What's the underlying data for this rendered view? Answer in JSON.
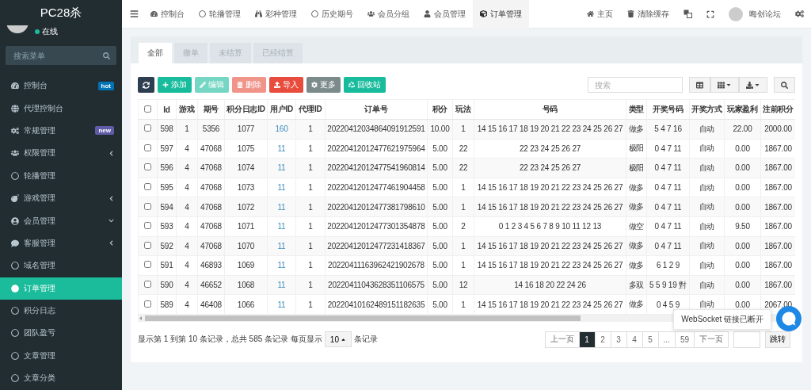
{
  "sidebar": {
    "title": "PC28杀",
    "status": "在线",
    "search": {
      "placeholder": "搜索菜单"
    },
    "items": [
      {
        "label": "控制台",
        "badge": {
          "text": "hot",
          "color": "#0073b7"
        },
        "selected": false
      },
      {
        "label": "代理控制台",
        "selected": false
      },
      {
        "label": "常规管理",
        "badge": {
          "text": "new",
          "color": "#605ca8"
        },
        "selected": false
      },
      {
        "label": "权限管理",
        "expanded": false,
        "selected": false
      },
      {
        "label": "轮播管理",
        "selected": false
      },
      {
        "label": "游戏管理",
        "expanded": false,
        "selected": false
      },
      {
        "label": "会员管理",
        "expanded": true,
        "selected": false
      },
      {
        "label": "客服管理",
        "expanded": false,
        "selected": false
      },
      {
        "label": "域名管理",
        "selected": false
      },
      {
        "label": "订单管理",
        "selected": true
      },
      {
        "label": "积分日志",
        "selected": false
      },
      {
        "label": "团队盈亏",
        "selected": false
      },
      {
        "label": "文章管理",
        "selected": false
      },
      {
        "label": "文章分类",
        "selected": false
      }
    ]
  },
  "topbar": {
    "nav": [
      {
        "label": "控制台",
        "selected": false
      },
      {
        "label": "轮播管理",
        "selected": false
      },
      {
        "label": "彩种管理",
        "selected": false
      },
      {
        "label": "历史期号",
        "selected": false
      },
      {
        "label": "会员分组",
        "selected": false
      },
      {
        "label": "会员管理",
        "selected": false
      },
      {
        "label": "订单管理",
        "selected": true
      }
    ],
    "home": "主页",
    "clear_cache": "清除缓存",
    "user": "晦创论坛"
  },
  "tabs": [
    {
      "label": "全部",
      "selected": true
    },
    {
      "label": "撤单",
      "selected": false
    },
    {
      "label": "未结算",
      "selected": false
    },
    {
      "label": "已经结算",
      "selected": false
    }
  ],
  "toolbar": {
    "buttons": [
      {
        "label": "添加",
        "disabled": false
      },
      {
        "label": "编辑",
        "disabled": true
      },
      {
        "label": "删除",
        "disabled": true
      },
      {
        "label": "导入",
        "disabled": false
      },
      {
        "label": "更多",
        "disabled": false
      },
      {
        "label": "回收站",
        "disabled": false
      }
    ],
    "search": {
      "placeholder": "搜索"
    }
  },
  "table": {
    "header_checked": false,
    "columns": [
      {
        "label": "Id",
        "kind": "text"
      },
      {
        "label": "游戏",
        "kind": "text"
      },
      {
        "label": "期号",
        "kind": "text"
      },
      {
        "label": "积分日志ID",
        "kind": "text"
      },
      {
        "label": "用户ID",
        "kind": "link"
      },
      {
        "label": "代理ID",
        "kind": "text"
      },
      {
        "label": "订单号",
        "kind": "text"
      },
      {
        "label": "积分",
        "kind": "text"
      },
      {
        "label": "玩法",
        "kind": "text"
      },
      {
        "label": "号码",
        "kind": "text"
      },
      {
        "label": "类型",
        "kind": "text"
      },
      {
        "label": "开奖号码",
        "kind": "text"
      },
      {
        "label": "开奖方式",
        "kind": "text"
      },
      {
        "label": "玩家盈利",
        "kind": "text"
      },
      {
        "label": "注前积分",
        "kind": "text"
      }
    ],
    "rows": [
      {
        "checked": false,
        "cells": [
          "598",
          "1",
          "5356",
          "1077",
          "160",
          "1",
          "20220412034864091912591",
          "10.00",
          "1",
          "14 15 16 17 18 19 20 21 22 23 24 25 26 27",
          "做多",
          "5 4 7 16",
          "自动",
          "22.00",
          "2000.00"
        ]
      },
      {
        "checked": false,
        "cells": [
          "597",
          "4",
          "47068",
          "1075",
          "11",
          "1",
          "20220412012477621975964",
          "5.00",
          "22",
          "22 23 24 25 26 27",
          "极阳",
          "0 4 7 11",
          "自动",
          "0.00",
          "1867.00"
        ]
      },
      {
        "checked": false,
        "cells": [
          "596",
          "4",
          "47068",
          "1074",
          "11",
          "1",
          "20220412012477541960814",
          "5.00",
          "22",
          "22 23 24 25 26 27",
          "极阳",
          "0 4 7 11",
          "自动",
          "0.00",
          "1867.00"
        ]
      },
      {
        "checked": false,
        "cells": [
          "595",
          "4",
          "47068",
          "1073",
          "11",
          "1",
          "20220412012477461904458",
          "5.00",
          "1",
          "14 15 16 17 18 19 20 21 22 23 24 25 26 27",
          "做多",
          "0 4 7 11",
          "自动",
          "0.00",
          "1867.00"
        ]
      },
      {
        "checked": false,
        "cells": [
          "594",
          "4",
          "47068",
          "1072",
          "11",
          "1",
          "20220412012477381798610",
          "5.00",
          "1",
          "14 15 16 17 18 19 20 21 22 23 24 25 26 27",
          "做多",
          "0 4 7 11",
          "自动",
          "0.00",
          "1867.00"
        ]
      },
      {
        "checked": false,
        "cells": [
          "593",
          "4",
          "47068",
          "1071",
          "11",
          "1",
          "20220412012477301354878",
          "5.00",
          "2",
          "0 1 2 3 4 5 6 7 8 9 10 11 12 13",
          "做空",
          "0 4 7 11",
          "自动",
          "9.50",
          "1867.00"
        ]
      },
      {
        "checked": false,
        "cells": [
          "592",
          "4",
          "47068",
          "1070",
          "11",
          "1",
          "20220412012477231418367",
          "5.00",
          "1",
          "14 15 16 17 18 19 20 21 22 23 24 25 26 27",
          "做多",
          "0 4 7 11",
          "自动",
          "0.00",
          "1867.00"
        ]
      },
      {
        "checked": false,
        "cells": [
          "591",
          "4",
          "46893",
          "1069",
          "11",
          "1",
          "20220411163962421902678",
          "5.00",
          "1",
          "14 15 16 17 18 19 20 21 22 23 24 25 26 27",
          "做多",
          "6 1 2 9",
          "自动",
          "0.00",
          "1867.00"
        ]
      },
      {
        "checked": false,
        "cells": [
          "590",
          "4",
          "46652",
          "1068",
          "11",
          "1",
          "20220411043628351106575",
          "5.00",
          "12",
          "14 16 18 20 22 24 26",
          "多双",
          "5 5 9 19 對",
          "自动",
          "0.00",
          "1867.00"
        ]
      },
      {
        "checked": false,
        "cells": [
          "589",
          "4",
          "46408",
          "1066",
          "11",
          "1",
          "20220410162489151182635",
          "5.00",
          "1",
          "14 15 16 17 18 19 20 21 22 23 24 25 26 27",
          "做多",
          "0 4 5 9",
          "自动",
          "0.00",
          "2067.00"
        ]
      }
    ]
  },
  "footer": {
    "summary": "显示第 1 到第 10 条记录，总共 585 条记录 每页显示",
    "page_size": "10",
    "suffix": "条记录",
    "pages": [
      {
        "label": "上一页",
        "selected": false
      },
      {
        "label": "1",
        "selected": true
      },
      {
        "label": "2",
        "selected": false
      },
      {
        "label": "3",
        "selected": false
      },
      {
        "label": "4",
        "selected": false
      },
      {
        "label": "5",
        "selected": false
      },
      {
        "label": "...",
        "selected": false
      },
      {
        "label": "59",
        "selected": false
      },
      {
        "label": "下一页",
        "selected": false
      }
    ],
    "jump": "跳转"
  },
  "toast": "WebSocket 链接已断开"
}
